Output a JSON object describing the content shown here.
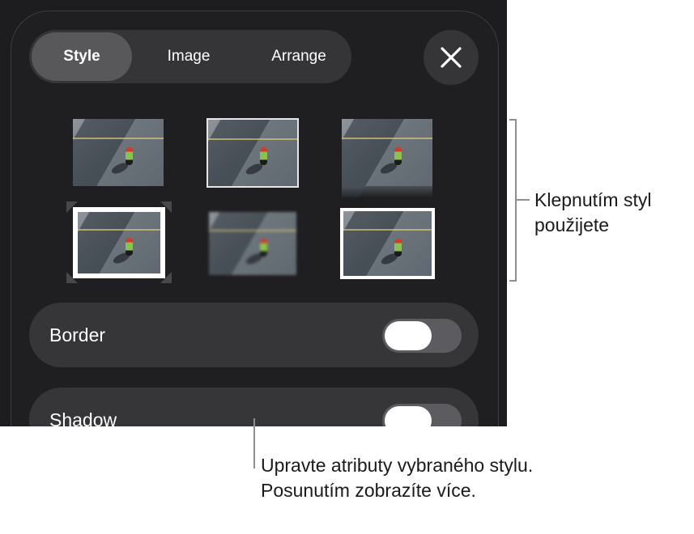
{
  "tabs": {
    "style": "Style",
    "image": "Image",
    "arrange": "Arrange",
    "active": "Style"
  },
  "close_button": {
    "icon": "close-icon"
  },
  "style_thumbnails": [
    {
      "name": "style-plain",
      "selected": false
    },
    {
      "name": "style-thin-border",
      "selected": false
    },
    {
      "name": "style-reflection",
      "selected": false
    },
    {
      "name": "style-photo-corners",
      "selected": false
    },
    {
      "name": "style-soft-edges",
      "selected": false
    },
    {
      "name": "style-white-frame",
      "selected": false
    }
  ],
  "options": {
    "border": {
      "label": "Border",
      "on": false
    },
    "shadow": {
      "label": "Shadow",
      "on": false
    }
  },
  "callouts": {
    "styles_line1": "Klepnutím styl",
    "styles_line2": "použijete",
    "attributes_line1": "Upravte atributy vybraného stylu.",
    "attributes_line2": "Posunutím zobrazíte více."
  },
  "colors": {
    "background": "#1d1d1f",
    "control": "#353537",
    "active_segment": "#58585b",
    "toggle_knob": "#ffffff"
  }
}
